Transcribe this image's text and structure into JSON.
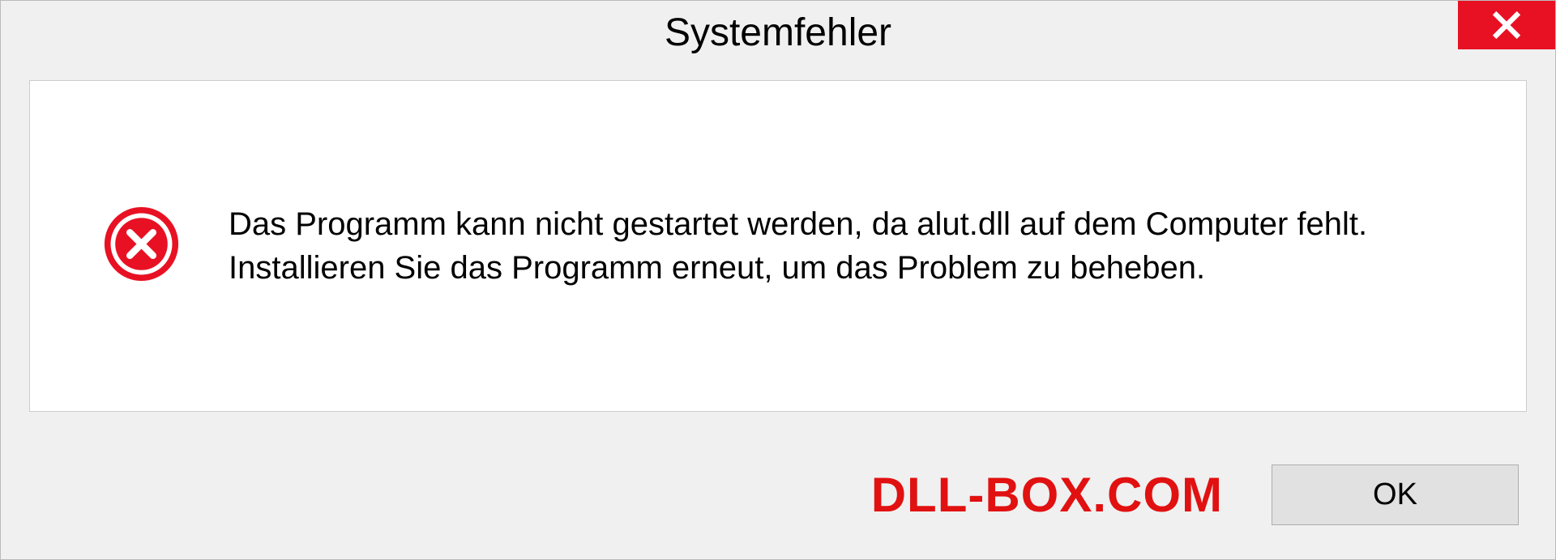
{
  "dialog": {
    "title": "Systemfehler",
    "message": "Das Programm kann nicht gestartet werden, da alut.dll auf dem Computer fehlt. Installieren Sie das Programm erneut, um das Problem zu beheben.",
    "ok_label": "OK"
  },
  "watermark": "DLL-BOX.COM"
}
